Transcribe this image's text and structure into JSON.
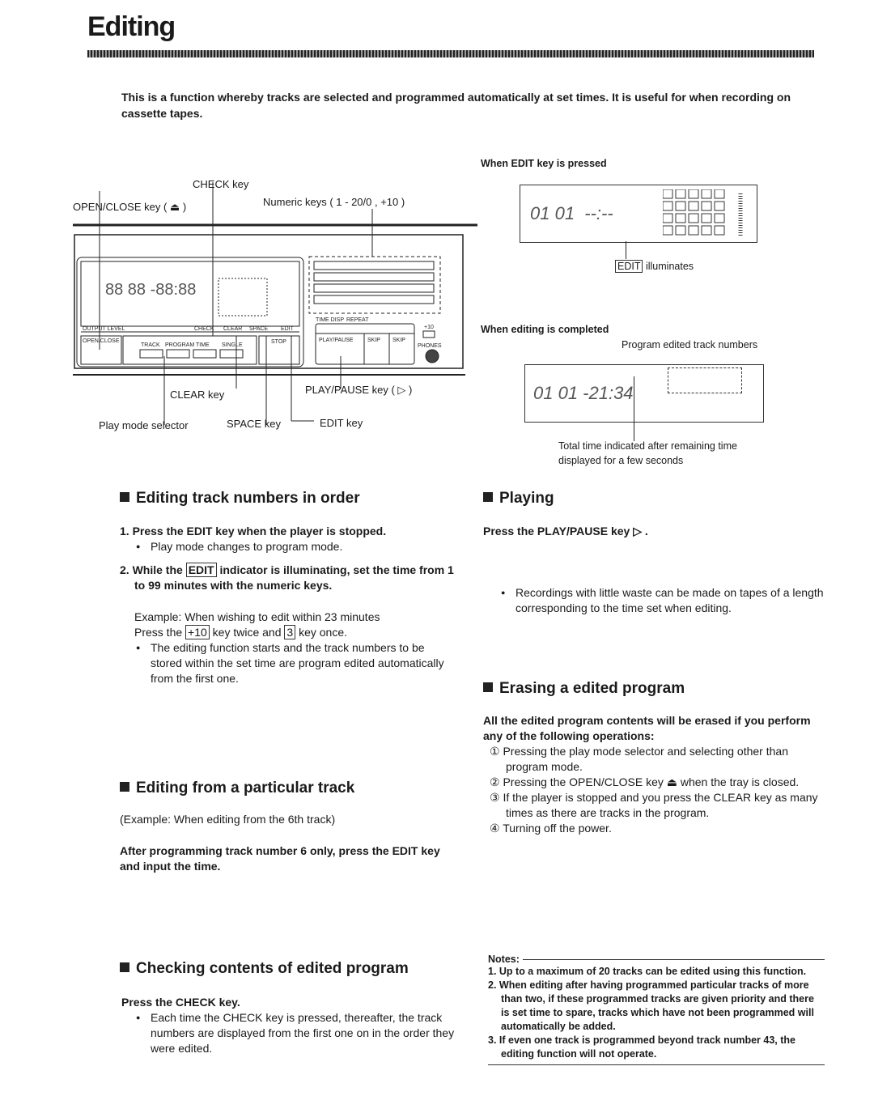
{
  "title": "Editing",
  "intro": "This is a function whereby tracks are selected and programmed automatically at set times. It is useful for when recording on cassette tapes.",
  "device_diagram": {
    "check_key": "CHECK key",
    "open_close_key": "OPEN/CLOSE key ( ⏏ )",
    "numeric_keys": "Numeric keys ( 1 - 20/0 , +10 )",
    "clear_key": "CLEAR key",
    "play_pause_key": "PLAY/PAUSE key ( ▷ )",
    "play_mode_selector": "Play mode selector",
    "space_key": "SPACE key",
    "edit_key": "EDIT key",
    "display_digits": "88 88 -88:88",
    "panel_labels": [
      "OPEN/CLOSE",
      "TRACK",
      "PROGRAM",
      "TIME",
      "SINGLE",
      "STOP",
      "PLAY/PAUSE",
      "SKIP",
      "SKIP",
      "PHONES",
      "CHECK",
      "CLEAR",
      "SPACE",
      "EDIT",
      "TIME DISP",
      "REPEAT",
      "+10",
      "OUTPUT LEVEL"
    ]
  },
  "edit_pressed": {
    "heading": "When EDIT key is pressed",
    "display": "01 01  --:--",
    "caption_box": "EDIT",
    "caption": "illuminates"
  },
  "edit_completed": {
    "heading": "When editing is completed",
    "top_caption": "Program edited track numbers",
    "display": "01 01 -21:34",
    "bottom_caption_1": "Total time indicated after remaining time",
    "bottom_caption_2": "displayed for a few seconds"
  },
  "sections": {
    "in_order": {
      "title": "Editing track numbers in order",
      "step1": "1. Press the EDIT key when the player is stopped.",
      "step1_bullet": "Play mode changes to program mode.",
      "step2_a": "2. While the",
      "step2_box": "EDIT",
      "step2_b": "indicator is illuminating, set the time from 1 to 99 minutes with the numeric keys.",
      "example_1": "Example: When wishing to edit within 23 minutes",
      "example_2a": "Press the",
      "example_2_box1": "+10",
      "example_2b": "key twice and",
      "example_2_box2": "3",
      "example_2c": "key once.",
      "bullet": "The editing function starts and the track numbers to be stored within the set time are program edited automatically from the first one."
    },
    "particular": {
      "title": "Editing from a particular track",
      "example": "(Example: When editing from the 6th track)",
      "instruction": "After programming track number 6 only, press the EDIT key and input the time."
    },
    "checking": {
      "title": "Checking contents of edited program",
      "instruction": "Press the CHECK key.",
      "bullet": "Each time the CHECK key is pressed, thereafter, the track numbers are displayed from the first one on in the order they were edited."
    },
    "playing": {
      "title": "Playing",
      "instruction": "Press the PLAY/PAUSE key ▷ .",
      "bullet": "Recordings with little waste can be made on tapes of a length corresponding to the time set when editing."
    },
    "erasing": {
      "title": "Erasing a edited program",
      "intro": "All the edited program contents will be erased if you perform any of the following operations:",
      "items": [
        "① Pressing the play mode selector and selecting other than program mode.",
        "② Pressing the OPEN/CLOSE key ⏏ when the tray is closed.",
        "③ If the player is stopped and you press the CLEAR key as many times as there are tracks in the program.",
        "④ Turning off the power."
      ]
    }
  },
  "notes": {
    "heading": "Notes:",
    "items": [
      "1. Up to a maximum of 20 tracks can be edited using this function.",
      "2. When editing after having programmed particular tracks of more than two, if these programmed tracks are given priority and there is set time to spare, tracks which have not been programmed will automatically be added.",
      "3. If even one track is programmed beyond track number 43, the editing function will not operate."
    ]
  }
}
